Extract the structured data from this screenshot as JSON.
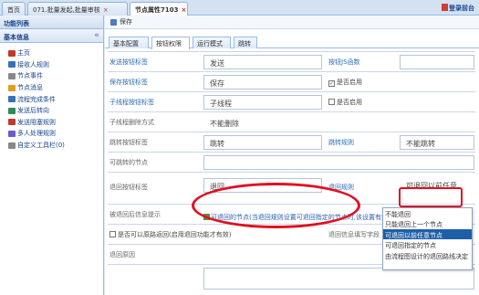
{
  "tabs": [
    {
      "label": "首页"
    },
    {
      "label": "071.批量发起,批量审核"
    },
    {
      "label": "节点属性7103"
    }
  ],
  "logout": "登录前台",
  "sidebar": {
    "title": "功能列表",
    "section": "基本信息",
    "items": [
      {
        "label": "主页",
        "color": "#c0392b"
      },
      {
        "label": "接收人规则",
        "color": "#3b6fb6"
      },
      {
        "label": "节点事件",
        "color": "#888"
      },
      {
        "label": "节点消息",
        "color": "#e0a020"
      },
      {
        "label": "流程完成条件",
        "color": "#3b6fb6"
      },
      {
        "label": "发送后转向",
        "color": "#2e8b57"
      },
      {
        "label": "发送阻塞规则",
        "color": "#c0392b"
      },
      {
        "label": "多人处理规则",
        "color": "#6a5acd"
      },
      {
        "label": "自定义工具栏(0)",
        "color": "#888"
      }
    ]
  },
  "toolbar": {
    "save": "保存"
  },
  "subtabs": [
    {
      "label": "基本配置"
    },
    {
      "label": "按钮权限"
    },
    {
      "label": "运行模式"
    },
    {
      "label": "跳转"
    }
  ],
  "form": {
    "send_label": "发送按钮标签",
    "send_value": "发送",
    "send_js": "按钮JS函数",
    "save_label": "保存按钮标签",
    "save_value": "保存",
    "save_enable": "是否启用",
    "subflow_label": "子线程按钮标签",
    "subflow_value": "子线程",
    "subflow_enable": "是否启用",
    "subflow_del": "子线程删除方式",
    "subflow_del_value": "不能删除",
    "jump_label": "跳转按钮标签",
    "jump_value": "跳转",
    "jump_rule": "跳转规则",
    "jump_rule_value": "不能跳转",
    "jump_nodes": "可跳转的节点",
    "return_label": "退回按钮标签",
    "return_value": "退回",
    "return_rule": "退回规则",
    "return_rule_value": "可退回以前任意",
    "return_link": "可退回的节点(当退回规则设置可退回指定的节点时,该设置有效)",
    "return_tip": "被退回后信息提示",
    "return_back": "是否可以原路返回(启用退回功能才有效)",
    "return_info": "退回信息填写字段",
    "return_reason": "退回原因"
  },
  "dropdown": {
    "options": [
      "不能退回",
      "只能退回上一个节点",
      "可退回以前任意节点",
      "可退回指定的节点",
      "由流程图设计的退回路线决定"
    ],
    "selected": 2
  }
}
